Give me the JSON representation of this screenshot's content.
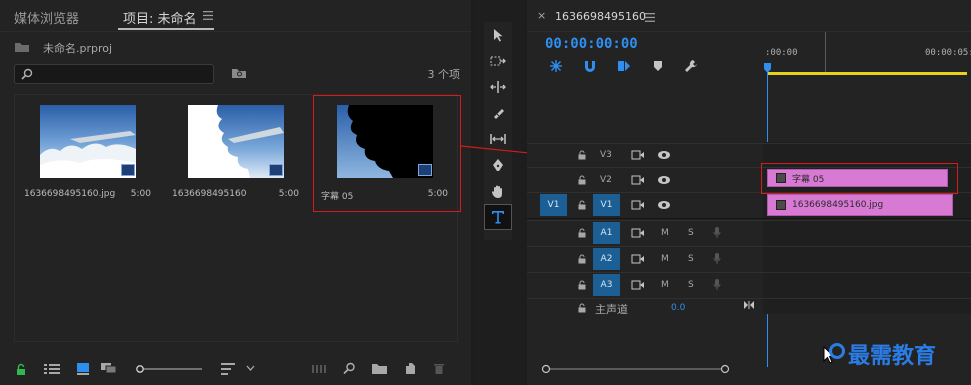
{
  "project_panel": {
    "tabs": [
      {
        "label": "媒体浏览器"
      },
      {
        "label": "项目: 未命名"
      }
    ],
    "project_file": "未命名.prproj",
    "item_count": "3 个项",
    "items": [
      {
        "name": "1636698495160.jpg",
        "duration": "5:00"
      },
      {
        "name": "1636698495160",
        "duration": "5:00"
      },
      {
        "name": "字幕 05",
        "duration": "5:00"
      }
    ]
  },
  "timeline": {
    "sequence_name": "1636698495160",
    "timecode": "00:00:00:00",
    "ruler": [
      ":00:00",
      "00:00:05:"
    ],
    "video_tracks": [
      {
        "name": "V3",
        "target": ""
      },
      {
        "name": "V2",
        "target": ""
      },
      {
        "name": "V1",
        "target": "V1"
      }
    ],
    "audio_tracks": [
      {
        "name": "A1",
        "m": "M",
        "s": "S"
      },
      {
        "name": "A2",
        "m": "M",
        "s": "S"
      },
      {
        "name": "A3",
        "m": "M",
        "s": "S"
      }
    ],
    "master": {
      "label": "主声道",
      "value": "0.0"
    },
    "clips": {
      "v2": "字幕 05",
      "v1": "1636698495160.jpg"
    }
  },
  "watermark": "最需教育",
  "colors": {
    "accent": "#2e8ff0",
    "clip": "#d87ad4",
    "highlight": "#d71a1a",
    "track_target": "#1b5f94"
  }
}
